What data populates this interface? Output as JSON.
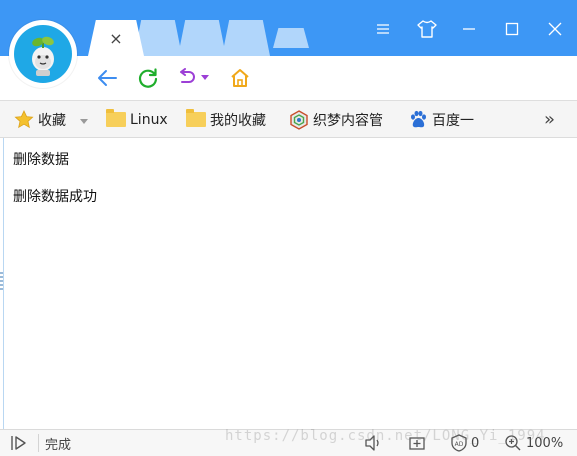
{
  "tabs": {
    "close_glyph": "×"
  },
  "window_controls": {
    "menu_icon": "menu-icon",
    "skin_icon": "tshirt-icon",
    "minimize_icon": "minimize-icon",
    "maximize_icon": "maximize-icon",
    "close_icon": "close-icon"
  },
  "nav": {
    "back_icon": "back-arrow-icon",
    "refresh_icon": "refresh-icon",
    "undo_icon": "undo-icon",
    "home_icon": "home-icon"
  },
  "bookmarks": {
    "favorites_label": "收藏",
    "items": [
      {
        "label": "Linux",
        "icon": "folder-icon"
      },
      {
        "label": "我的收藏",
        "icon": "folder-icon"
      },
      {
        "label": "织梦内容管",
        "icon": "dedecms-icon"
      },
      {
        "label": "百度一",
        "icon": "baidu-paw-icon"
      }
    ],
    "more_glyph": "»"
  },
  "content": {
    "lines": [
      "删除数据",
      "删除数据成功"
    ]
  },
  "status": {
    "text": "完成",
    "adblock_count": "0",
    "zoom": "100%"
  },
  "watermark": "https://blog.csdn.net/LONG_Yi_1994",
  "colors": {
    "titlebar": "#3d97f5",
    "tab_inactive": "#b1d6fb",
    "back_arrow": "#3d8df0",
    "refresh": "#1fae2c",
    "undo": "#9c3fd6",
    "home": "#f0a81a"
  }
}
